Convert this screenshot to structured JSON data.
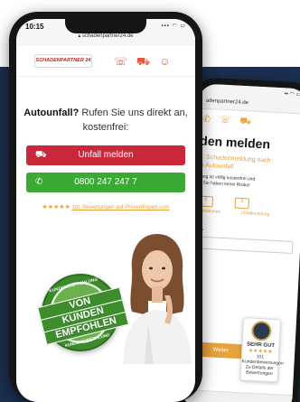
{
  "front": {
    "time": "10:15",
    "status_icons": "▪▪▪ ◠ ▭",
    "url": "schadenpartner24.de",
    "logo_text": "SCHADENPARTNER 24",
    "headline_bold": "Autounfall?",
    "headline_rest": " Rufen Sie uns direkt an, kostenfrei:",
    "btn_report": "Unfall melden",
    "btn_phone": "0800 247 247 7",
    "review_stars": "★★★★★",
    "review_link": "101 Bewertungen auf ProvenExpert.com",
    "stamp_top": "KUNDENEMPFEHLUNG",
    "stamp_line1": "VON",
    "stamp_line2": "KUNDEN",
    "stamp_line3": "EMPFOHLEN",
    "stamp_bottom": "KUNDENEMPFEHLUNG"
  },
  "back": {
    "status": "▪▪ ◠ ▭",
    "url": "adenpartner24.de",
    "title": "den melden",
    "subtitle_1": "n: Schadenmeldung nach",
    "subtitle_2": "m Autounfall",
    "text_1": "dung ist völlig kostenfrei und",
    "text_2": "n. Sie haben keine Risiko!",
    "step_2": "2",
    "step_3": "3",
    "step_label_1": "nformationen",
    "step_label_2": "Unfallmeldung",
    "question": "d? *",
    "btn_next": "Weiter",
    "badge_title": "SEHR GUT",
    "badge_stars": "★★★★★",
    "badge_count": "101 Kundenbewertungen",
    "badge_link": "Zu Details der Bewertungen"
  },
  "colors": {
    "red": "#c8283a",
    "green": "#3aaa35",
    "orange": "#e8a23c",
    "navy": "#1b2f4e"
  }
}
